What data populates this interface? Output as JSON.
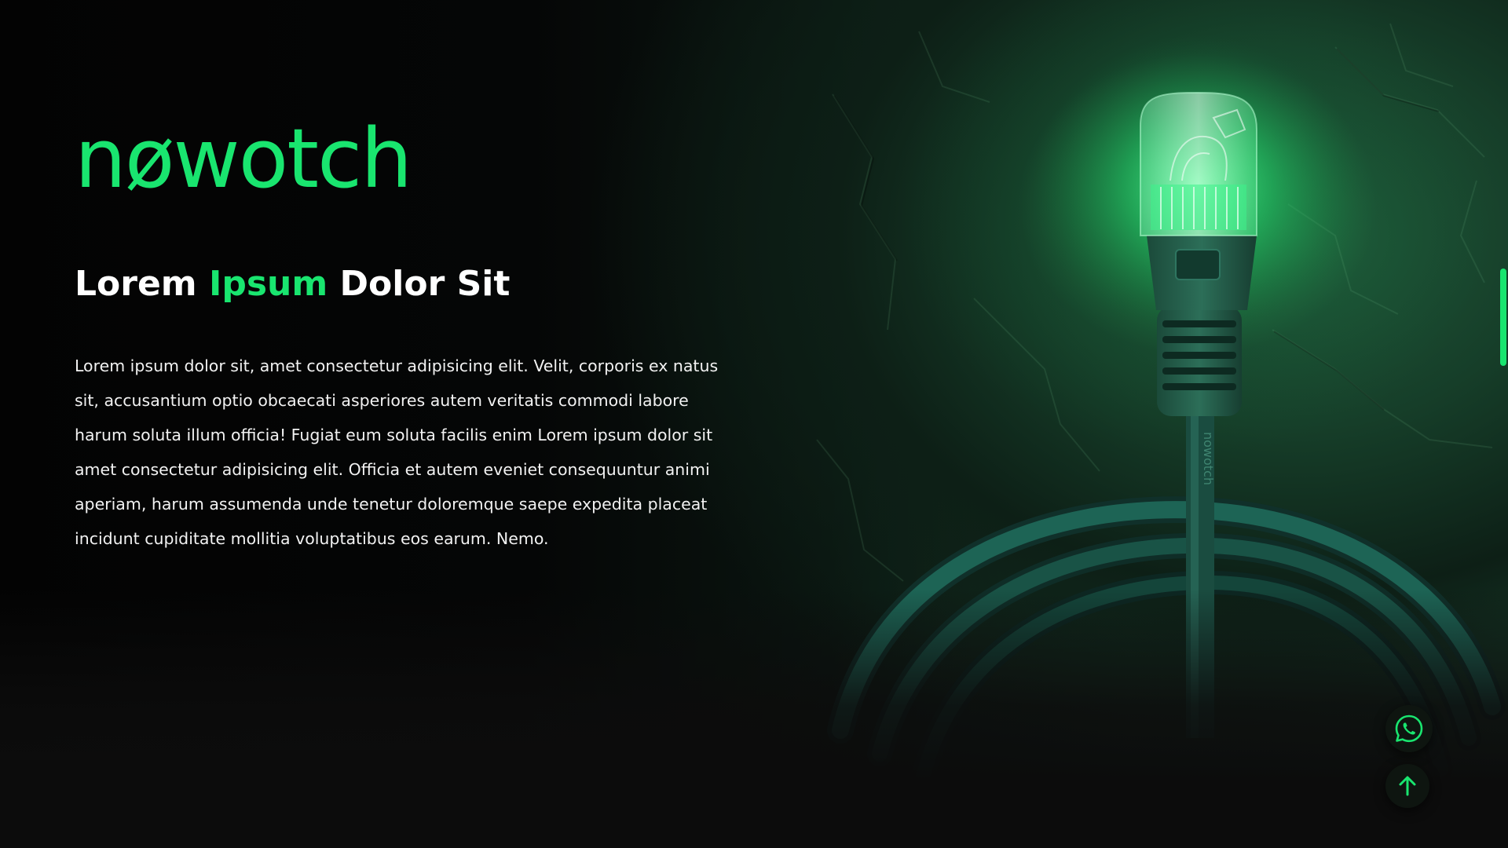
{
  "brand": {
    "logo_text": "nøwotch",
    "accent_color": "#19e56f"
  },
  "hero": {
    "headline_part1": "Lorem ",
    "headline_accent": "Ipsum",
    "headline_part2": " Dolor Sit",
    "body": "Lorem ipsum dolor sit, amet consectetur adipisicing elit. Velit, corporis ex natus sit, accusantium optio obcaecati asperiores autem veritatis commodi labore harum soluta illum officia! Fugiat eum soluta facilis enim Lorem ipsum dolor sit amet consectetur adipisicing elit. Officia et autem eveniet consequuntur animi aperiam, harum assumenda unde tenetur doloremque saepe expedita placeat incidunt cupiditate mollitia voluptatibus eos earum. Nemo.",
    "cable_imprint": "nowotch"
  },
  "floating_actions": {
    "whatsapp_icon": "whatsapp-icon",
    "scroll_top_icon": "arrow-up-icon"
  },
  "colors": {
    "background": "#0c0c0c",
    "text": "#ffffff",
    "accent": "#19e56f"
  }
}
